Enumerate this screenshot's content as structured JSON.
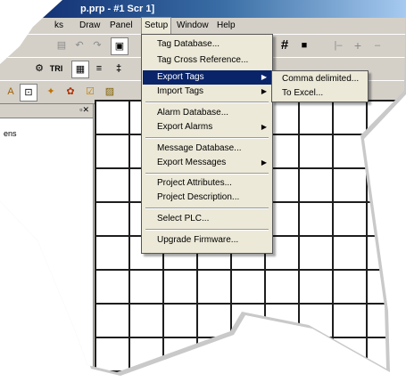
{
  "window": {
    "title": "p.prp - #1 Scr 1]"
  },
  "menubar": [
    "ks",
    "Draw",
    "Panel",
    "Setup",
    "Window",
    "Help"
  ],
  "toolbar1": [
    "grid-icon",
    "snap-icon",
    "pipe-icon",
    "cross-icon",
    "dash-icon"
  ],
  "toolbar2": {
    "tri_label": "TRI"
  },
  "leftpane": {
    "node_text": "ens"
  },
  "setup_menu": {
    "items": [
      {
        "label": "Tag Database...",
        "submenu": false
      },
      {
        "label": "Tag Cross Reference...",
        "submenu": false
      },
      {
        "label": "Export Tags",
        "submenu": true,
        "highlighted": true
      },
      {
        "label": "Import Tags",
        "submenu": true
      },
      {
        "label": "Alarm Database...",
        "submenu": false
      },
      {
        "label": "Export Alarms",
        "submenu": true
      },
      {
        "label": "Message Database...",
        "submenu": false
      },
      {
        "label": "Export Messages",
        "submenu": true
      },
      {
        "label": "Project Attributes...",
        "submenu": false
      },
      {
        "label": "Project Description...",
        "submenu": false
      },
      {
        "label": "Select PLC...",
        "submenu": false
      },
      {
        "label": "Upgrade Firmware...",
        "submenu": false
      }
    ]
  },
  "export_tags_submenu": {
    "items": [
      {
        "label": "Comma delimited..."
      },
      {
        "label": "To Excel..."
      }
    ]
  },
  "colors": {
    "highlight": "#0a246a",
    "menu_bg": "#ece9d8",
    "chrome": "#d4d0c8",
    "titlebar": "#0a246a"
  }
}
